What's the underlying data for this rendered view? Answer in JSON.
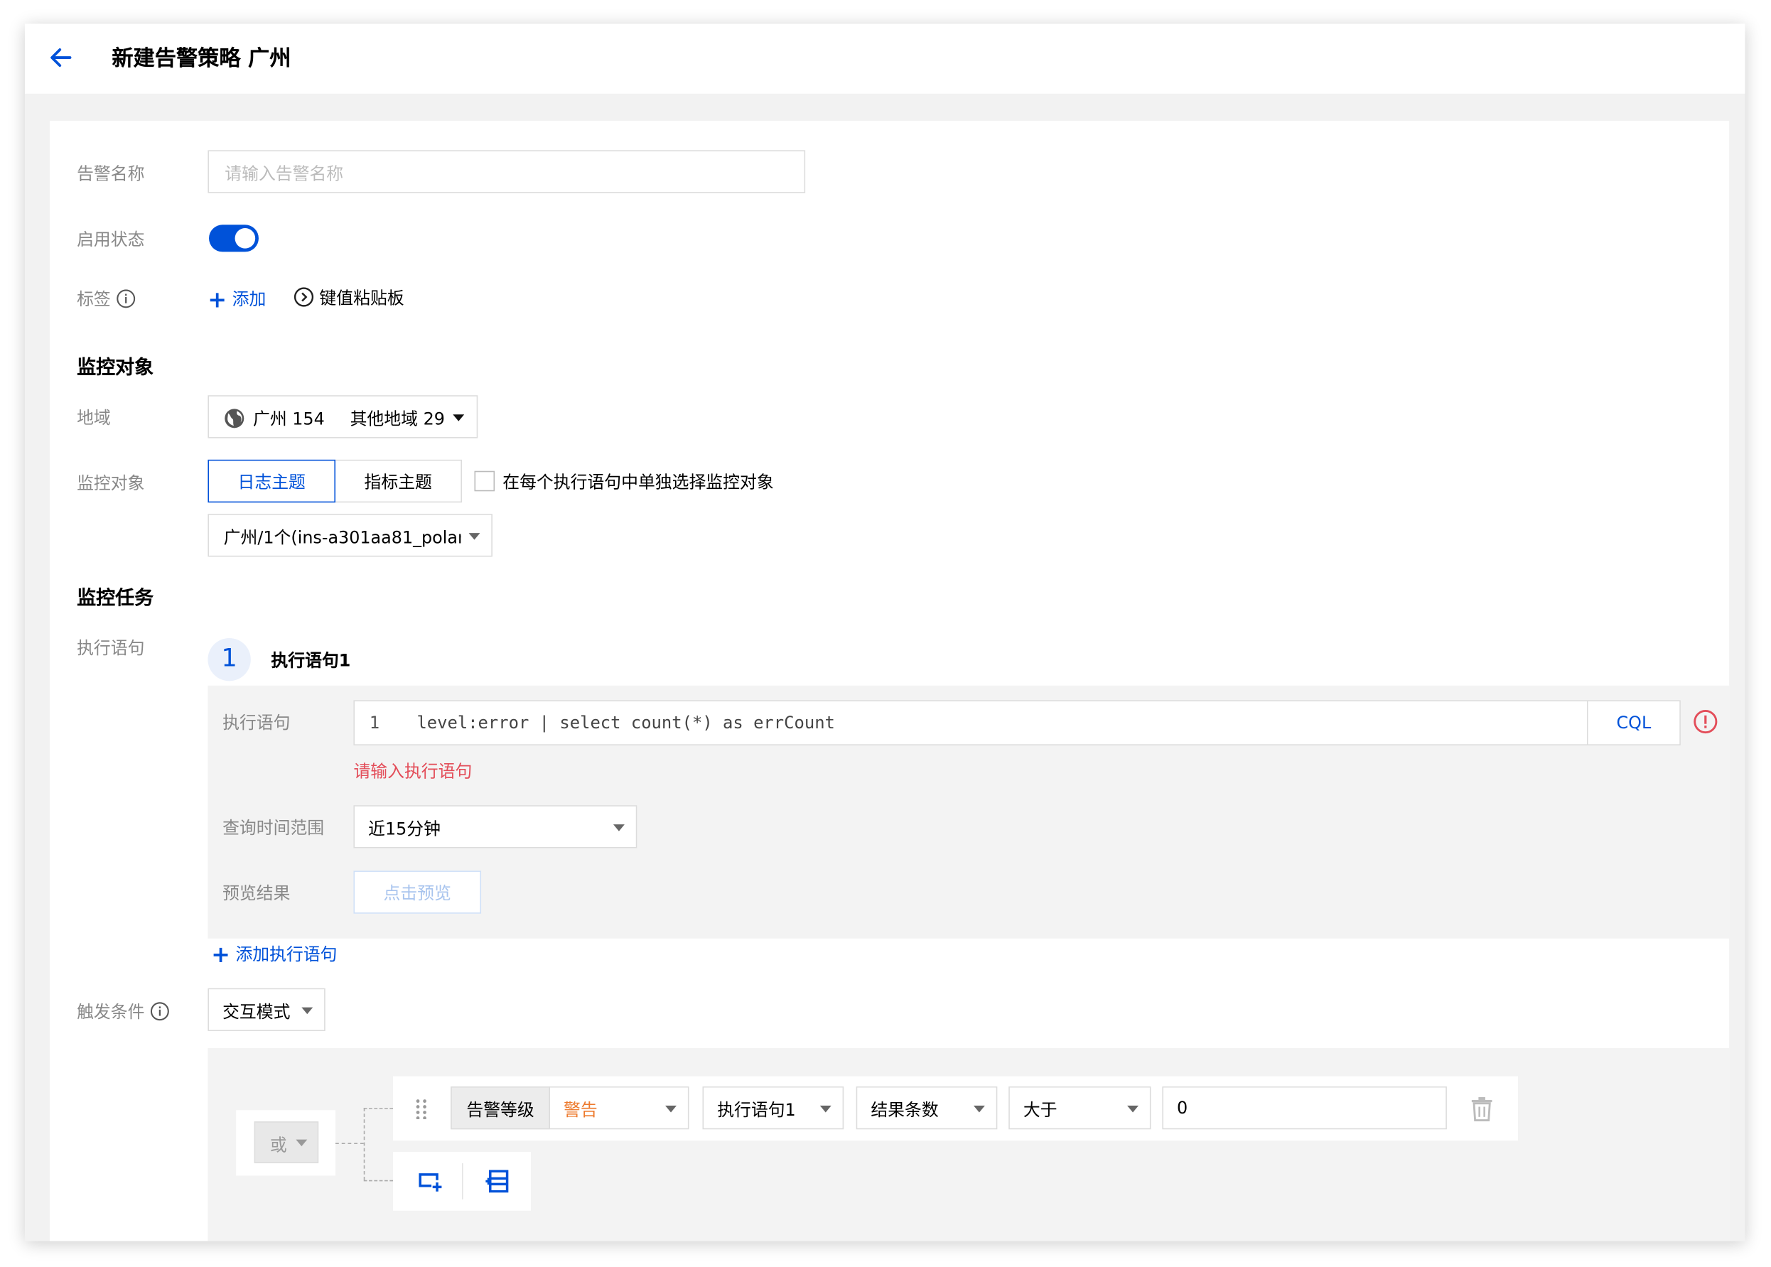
{
  "header": {
    "title": "新建告警策略 广州"
  },
  "colors": {
    "accent": "#0052d9",
    "error": "#e34d59",
    "warning": "#ed7b2f"
  },
  "form": {
    "alert_name": {
      "label": "告警名称",
      "placeholder": "请输入告警名称",
      "value": ""
    },
    "enable": {
      "label": "启用状态",
      "on": true
    },
    "tags": {
      "label": "标签",
      "add_label": "添加",
      "paste_label": "键值粘贴板"
    }
  },
  "monitor_object": {
    "section_title": "监控对象",
    "region": {
      "label": "地域",
      "primary": "广州 154",
      "other": "其他地域 29"
    },
    "object": {
      "label": "监控对象",
      "tabs": [
        "日志主题",
        "指标主题"
      ],
      "active_tab": "日志主题",
      "checkbox_label": "在每个执行语句中单独选择监控对象",
      "topic_select": "广州/1个(ins-a301aa81_polari:"
    }
  },
  "monitor_task": {
    "section_title": "监控任务",
    "statement_label": "执行语句",
    "statement": {
      "index": "1",
      "title": "执行语句1",
      "query_label": "执行语句",
      "line_no": "1",
      "query": "level:error | select count(*) as errCount",
      "syntax": "CQL",
      "error_text": "请输入执行语句",
      "time_range_label": "查询时间范围",
      "time_range": "近15分钟",
      "preview_label": "预览结果",
      "preview_button": "点击预览"
    },
    "add_statement": "添加执行语句"
  },
  "trigger": {
    "label": "触发条件",
    "mode": "交互模式",
    "logic": "或",
    "condition": {
      "level_label": "告警等级",
      "level_value": "警告",
      "statement": "执行语句1",
      "metric": "结果条数",
      "operator": "大于",
      "value": "0"
    }
  }
}
